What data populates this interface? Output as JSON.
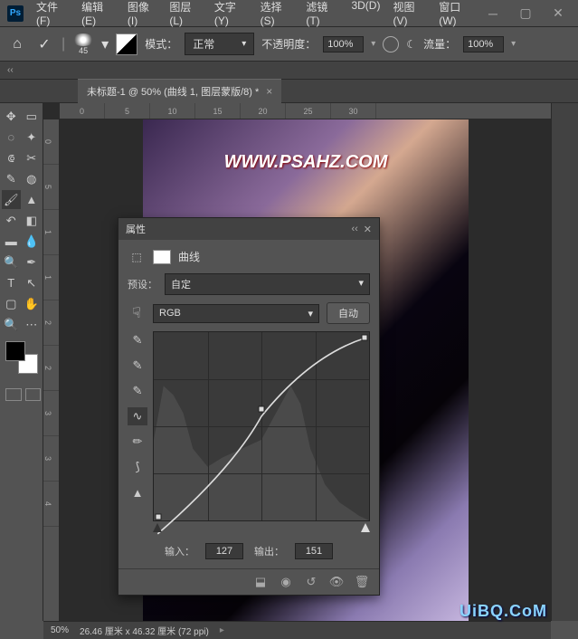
{
  "app": {
    "logo": "Ps"
  },
  "menu": {
    "file": "文件(F)",
    "edit": "编辑(E)",
    "image": "图像(I)",
    "layer": "图层(L)",
    "type": "文字(Y)",
    "select": "选择(S)",
    "filter": "滤镜(T)",
    "3d": "3D(D)",
    "view": "视图(V)",
    "window": "窗口(W)"
  },
  "options": {
    "brush_size": "45",
    "mode_label": "模式：",
    "mode_value": "正常",
    "opacity_label": "不透明度：",
    "opacity_value": "100%",
    "flow_label": "流量：",
    "flow_value": "100%"
  },
  "doc": {
    "tab_title": "未标题-1 @ 50% (曲线 1, 图层蒙版/8) *"
  },
  "ruler_h": [
    "0",
    "5",
    "10",
    "15",
    "20",
    "25",
    "30"
  ],
  "ruler_v": [
    "0",
    "5",
    "1",
    "1",
    "2",
    "2",
    "3",
    "3",
    "4"
  ],
  "canvas_watermark": "WWW.PSAHZ.COM",
  "properties": {
    "title": "属性",
    "adj_label": "曲线",
    "preset_label": "预设：",
    "preset_value": "自定",
    "channel_value": "RGB",
    "auto_label": "自动",
    "input_label": "输入：",
    "input_value": "127",
    "output_label": "输出：",
    "output_value": "151"
  },
  "chart_data": {
    "type": "line",
    "title": "曲线",
    "xlabel": "输入",
    "ylabel": "输出",
    "xlim": [
      0,
      255
    ],
    "ylim": [
      0,
      255
    ],
    "series": [
      {
        "name": "RGB",
        "values": [
          [
            0,
            0
          ],
          [
            127,
            151
          ],
          [
            255,
            255
          ]
        ]
      }
    ],
    "histogram_hint": "dark-heavy image with secondary mid peak"
  },
  "status": {
    "zoom": "50%",
    "doc_info": "26.46 厘米 x 46.32 厘米 (72 ppi)"
  },
  "brand": "UiBQ.CoM"
}
